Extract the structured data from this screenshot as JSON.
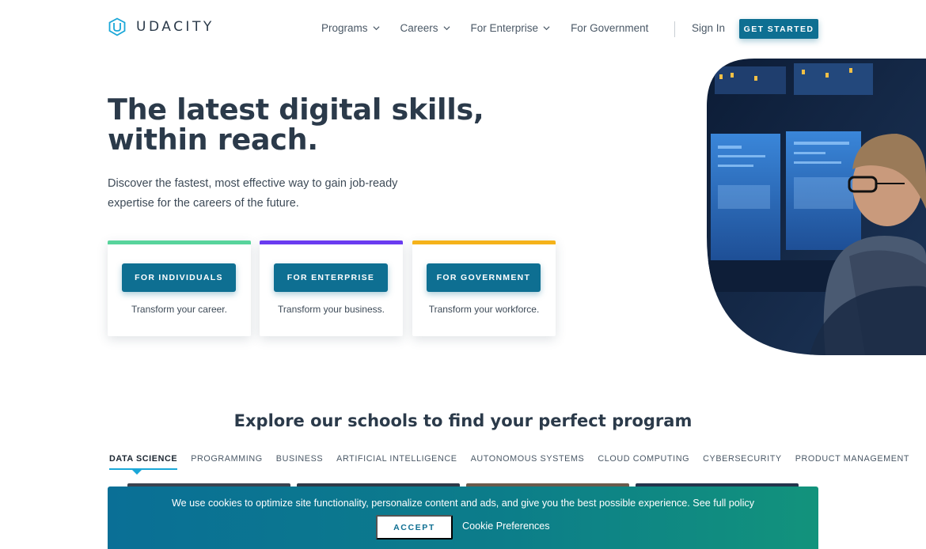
{
  "header": {
    "logo_text": "UDACITY",
    "nav": [
      {
        "label": "Programs",
        "dropdown": true
      },
      {
        "label": "Careers",
        "dropdown": true
      },
      {
        "label": "For Enterprise",
        "dropdown": true
      },
      {
        "label": "For Government",
        "dropdown": false
      }
    ],
    "sign_in": "Sign In",
    "get_started": "GET STARTED"
  },
  "hero": {
    "title_line1": "The latest digital skills,",
    "title_line2": "within reach.",
    "subtitle": "Discover the fastest, most effective way to gain job-ready expertise for the careers of the future."
  },
  "cards": [
    {
      "button": "FOR INDIVIDUALS",
      "desc": "Transform your career.",
      "accent": "#58d49c"
    },
    {
      "button": "FOR ENTERPRISE",
      "desc": "Transform your business.",
      "accent": "#6a3bf0"
    },
    {
      "button": "FOR GOVERNMENT",
      "desc": "Transform your workforce.",
      "accent": "#f5b21a"
    }
  ],
  "schools": {
    "title": "Explore our schools to find your perfect program",
    "tabs": [
      "DATA SCIENCE",
      "PROGRAMMING",
      "BUSINESS",
      "ARTIFICIAL INTELLIGENCE",
      "AUTONOMOUS SYSTEMS",
      "CLOUD COMPUTING",
      "CYBERSECURITY",
      "PRODUCT MANAGEMENT"
    ],
    "active_tab": "DATA SCIENCE"
  },
  "cookie": {
    "text": "We use cookies to optimize site functionality, personalize content and ads, and give you the best possible experience. See full policy",
    "accept": "ACCEPT",
    "preferences": "Cookie Preferences"
  },
  "colors": {
    "brand": "#0e6f92",
    "text_dark": "#2b3a4a",
    "tab_underline": "#1aa7d8"
  }
}
